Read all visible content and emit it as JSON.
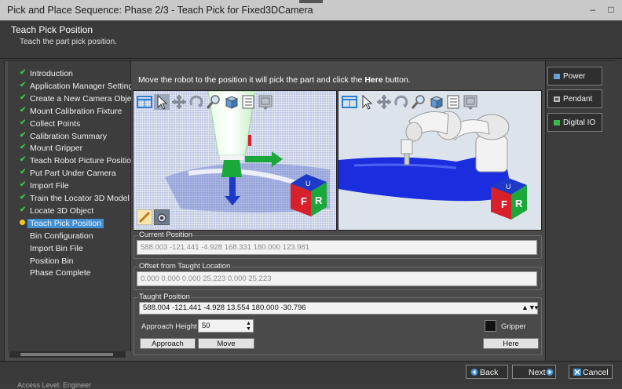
{
  "window": {
    "title": "Pick and Place Sequence: Phase 2/3 - Teach Pick for Fixed3DCamera"
  },
  "header": {
    "title": "Teach Pick Position",
    "subtitle": "Teach the part pick position."
  },
  "nav": {
    "items": [
      {
        "label": "Introduction",
        "state": "done"
      },
      {
        "label": "Application Manager Settings",
        "state": "done"
      },
      {
        "label": "Create a New Camera Object",
        "state": "done"
      },
      {
        "label": "Mount Calibration Fixture",
        "state": "done"
      },
      {
        "label": "Collect Points",
        "state": "done"
      },
      {
        "label": "Calibration Summary",
        "state": "done"
      },
      {
        "label": "Mount Gripper",
        "state": "done"
      },
      {
        "label": "Teach Robot Picture Position.",
        "state": "done"
      },
      {
        "label": "Put Part Under Camera",
        "state": "done"
      },
      {
        "label": "Import File",
        "state": "done"
      },
      {
        "label": "Train the Locator 3D Model",
        "state": "done"
      },
      {
        "label": "Locate 3D Object",
        "state": "done"
      },
      {
        "label": "Teach Pick Position",
        "state": "current"
      },
      {
        "label": "Bin Configuration",
        "state": "pending"
      },
      {
        "label": "Import Bin File",
        "state": "pending"
      },
      {
        "label": "Position Bin",
        "state": "pending"
      },
      {
        "label": "Phase Complete",
        "state": "pending"
      }
    ]
  },
  "main": {
    "instruction_prefix": "Move the robot to the position it will pick the part and click the ",
    "instruction_bold": "Here",
    "instruction_suffix": " button."
  },
  "views": {
    "cube_front_label": "F",
    "cube_right_label": "R",
    "cube_top_label": "U"
  },
  "current_position": {
    "caption": "Current Position",
    "value": "588.003 -121.441 -4.928 168.331 180.000 123.981"
  },
  "offset": {
    "caption": "Offset from Taught Location",
    "value": "0.000 0.000 0.000 25.223 0.000 25.223"
  },
  "taught": {
    "caption": "Taught Position",
    "value": "588.004 -121.441 -4.928 13.554 180.000 -30.796",
    "approach_label": "Approach Height",
    "approach_value": "50",
    "gripper_label": "Gripper",
    "approach_button": "Approach",
    "move_button": "Move",
    "here_button": "Here"
  },
  "right_panel": {
    "power": "Power",
    "pendant": "Pendant",
    "digital_io": "Digital IO"
  },
  "footer": {
    "back": "Back",
    "next": "Next",
    "cancel": "Cancel"
  },
  "status": {
    "access_level": "Access Level: Engineer"
  },
  "colors": {
    "accent": "#3f8fd2",
    "check": "#35c84a",
    "point_cloud": "#1a2ee0",
    "cube_red": "#d8202a",
    "cube_green": "#1aa83a",
    "cube_blue": "#1d39c8"
  }
}
